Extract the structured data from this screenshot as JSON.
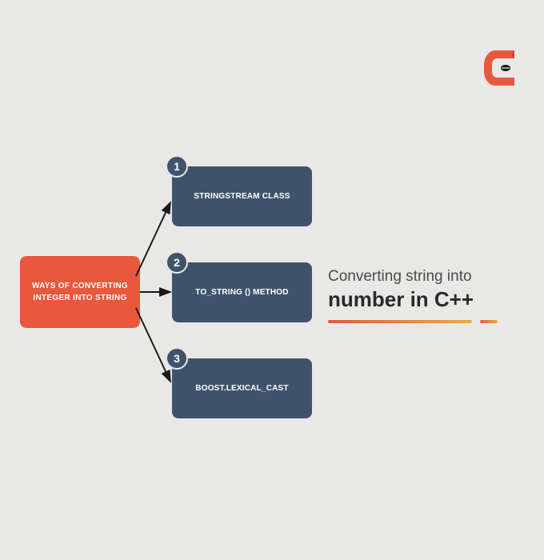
{
  "logo": {
    "name": "logo-c-ninja"
  },
  "source": {
    "label": "WAYS OF CONVERTING INTEGER INTO STRING"
  },
  "methods": [
    {
      "num": "1",
      "label": "STRINGSTREAM CLASS"
    },
    {
      "num": "2",
      "label": "TO_STRING () METHOD"
    },
    {
      "num": "3",
      "label": "BOOST.LEXICAL_CAST"
    }
  ],
  "title": {
    "small": "Converting string into",
    "big": "number in C++"
  },
  "colors": {
    "accent_orange": "#e7583d",
    "box_blue": "#3e546d",
    "bg": "#e8e8e6"
  }
}
